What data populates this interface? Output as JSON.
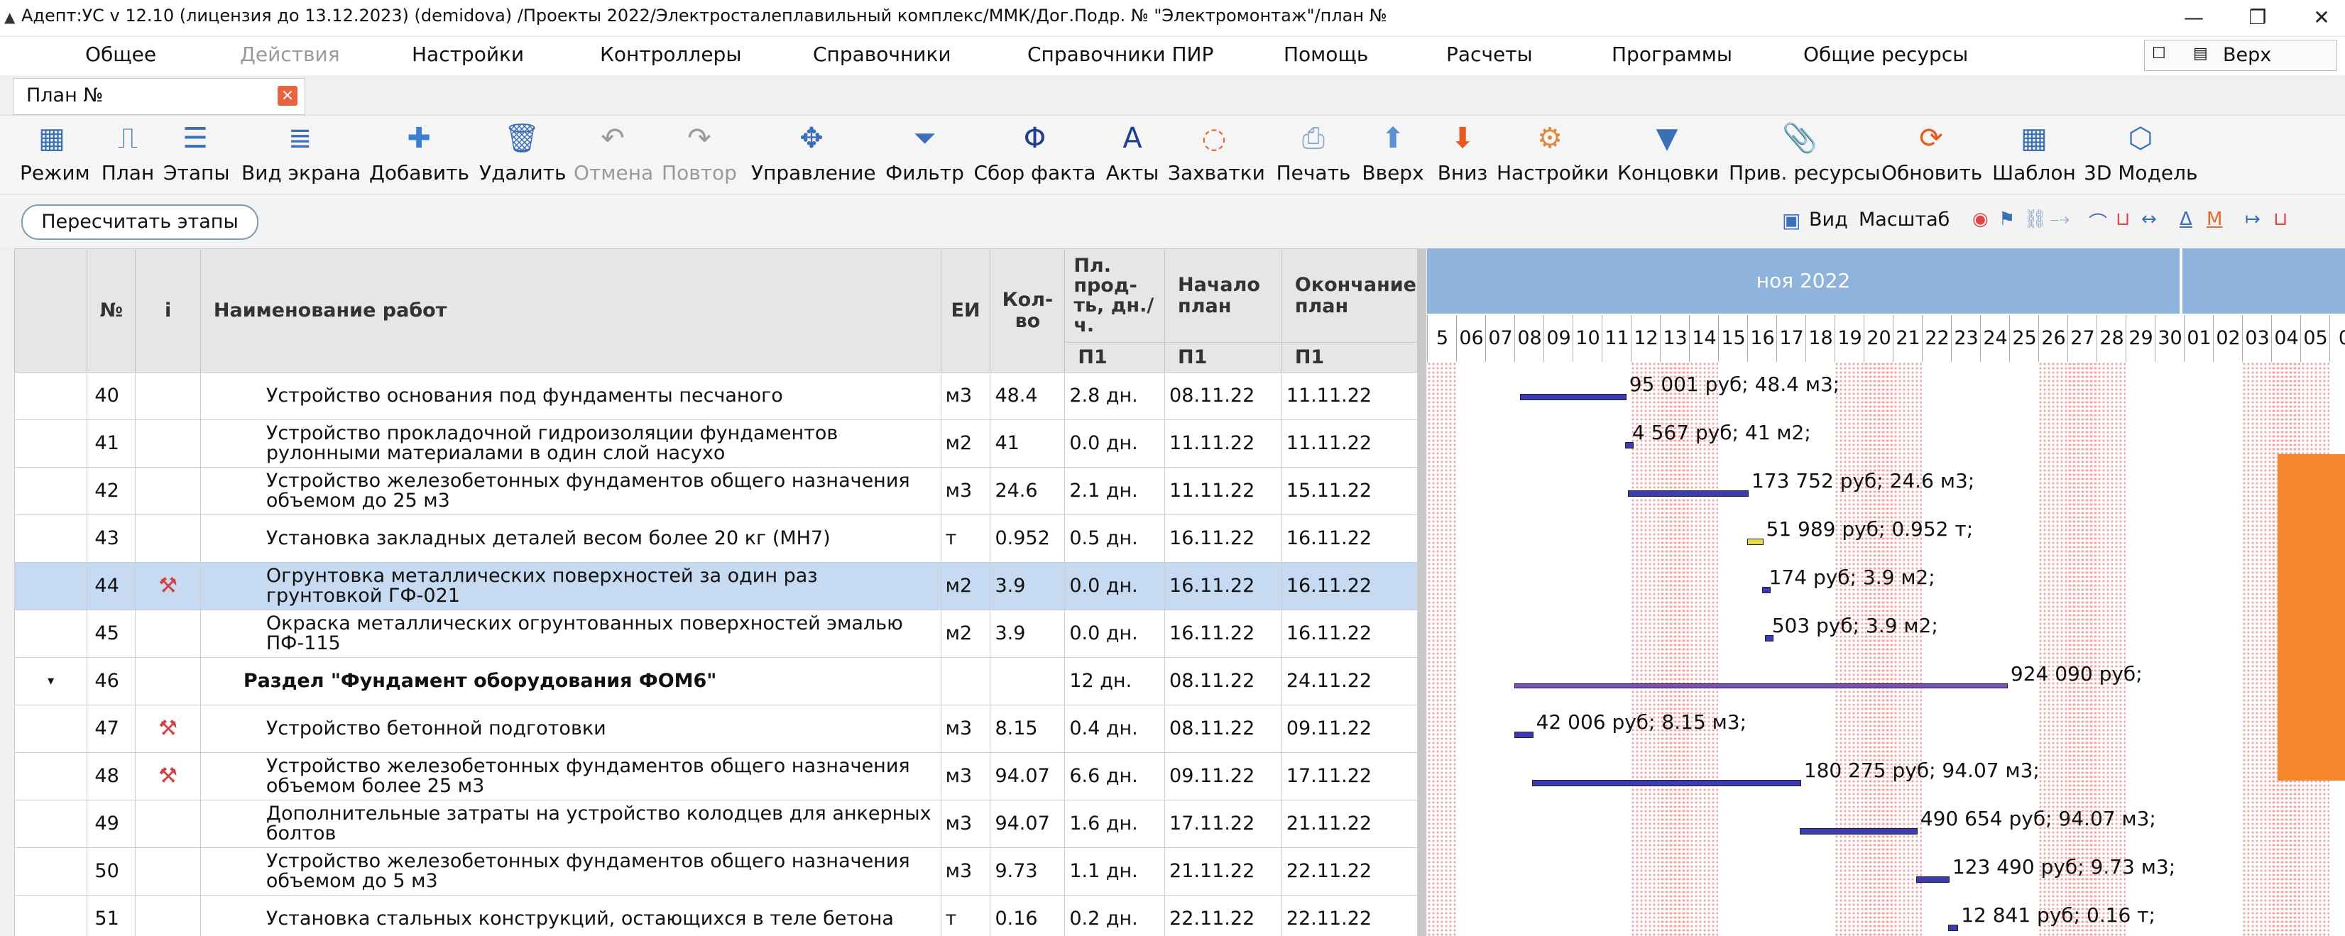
{
  "title_bar": {
    "title": "Адепт:УС v 12.10 (лицензия до 13.12.2023) (demidova) /Проекты 2022/Электросталеплавильный комплекс/ММК/Дог.Подр. №  \"Электромонтаж\"/план №",
    "minimize": "—",
    "restore": "❐",
    "close": "✕"
  },
  "menu": {
    "items": [
      "Общее",
      "Действия",
      "Настройки",
      "Контроллеры",
      "Справочники",
      "Справочники ПИР",
      "Помощь",
      "Расчеты",
      "Программы",
      "Общие ресурсы"
    ],
    "disabled_item": "Действия",
    "placement_value": "Верх"
  },
  "doc_tab": {
    "label": "План №",
    "close": "×"
  },
  "toolbar": {
    "buttons": [
      {
        "label": "Режим",
        "icon": "mode-icon"
      },
      {
        "label": "План",
        "icon": "plan-icon"
      },
      {
        "label": "Этапы",
        "icon": "stages-icon"
      },
      {
        "label": "Вид экрана",
        "icon": "screen-view-icon"
      },
      {
        "label": "Добавить",
        "icon": "add-icon"
      },
      {
        "label": "Удалить",
        "icon": "trash-icon"
      },
      {
        "label": "Отмена",
        "icon": "undo-icon"
      },
      {
        "label": "Повтор",
        "icon": "redo-icon"
      },
      {
        "label": "Управление",
        "icon": "move-icon"
      },
      {
        "label": "Фильтр",
        "icon": "filter-icon"
      },
      {
        "label": "Сбор факта",
        "icon": "fact-icon"
      },
      {
        "label": "Акты",
        "icon": "acts-icon"
      },
      {
        "label": "Захватки",
        "icon": "grips-icon"
      },
      {
        "label": "Печать",
        "icon": "print-icon"
      },
      {
        "label": "Вверх",
        "icon": "arrow-up-icon"
      },
      {
        "label": "Вниз",
        "icon": "arrow-down-icon"
      },
      {
        "label": "Настройки",
        "icon": "settings-icon"
      },
      {
        "label": "Концовки",
        "icon": "endings-icon"
      },
      {
        "label": "Прив. ресурсы",
        "icon": "resources-icon"
      },
      {
        "label": "Обновить",
        "icon": "refresh-icon"
      },
      {
        "label": "Шаблон",
        "icon": "template-icon"
      },
      {
        "label": "3D Модель",
        "icon": "model-3d-icon"
      }
    ],
    "disabled_labels": [
      "Отмена",
      "Повтор"
    ]
  },
  "actions": {
    "recalc": "Пересчитать этапы",
    "view_label": "Вид",
    "scale_label": "Масштаб"
  },
  "grid": {
    "headers": {
      "num": "№",
      "info": "i",
      "name": "Наименование работ",
      "unit": "ЕИ",
      "qty": "Кол-во",
      "duration": "Пл. прод-ть, дн./ч.",
      "start": "Начало план",
      "end": "Окончание план",
      "sub_duration": "П1",
      "sub_start": "П1",
      "sub_end": "П1"
    },
    "rows": [
      {
        "num": "40",
        "name": "Устройство основания под фундаменты песчаного",
        "unit": "м3",
        "qty": "48.4",
        "dur": "2.8 дн.",
        "start": "08.11.22",
        "end": "11.11.22",
        "icon": "",
        "section": false
      },
      {
        "num": "41",
        "name": "Устройство прокладочной гидроизоляции фундаментов рулонными материалами в один слой насухо",
        "unit": "м2",
        "qty": "41",
        "dur": "0.0 дн.",
        "start": "11.11.22",
        "end": "11.11.22",
        "icon": "",
        "section": false
      },
      {
        "num": "42",
        "name": "Устройство железобетонных фундаментов общего назначения объемом до 25 м3",
        "unit": "м3",
        "qty": "24.6",
        "dur": "2.1 дн.",
        "start": "11.11.22",
        "end": "15.11.22",
        "icon": "",
        "section": false
      },
      {
        "num": "43",
        "name": "Установка закладных деталей весом более 20 кг (МН7)",
        "unit": "т",
        "qty": "0.952",
        "dur": "0.5 дн.",
        "start": "16.11.22",
        "end": "16.11.22",
        "icon": "",
        "section": false
      },
      {
        "num": "44",
        "name": "Огрунтовка металлических поверхностей за один раз грунтовкой ГФ-021",
        "unit": "м2",
        "qty": "3.9",
        "dur": "0.0 дн.",
        "start": "16.11.22",
        "end": "16.11.22",
        "icon": "crane-icon",
        "section": false
      },
      {
        "num": "45",
        "name": "Окраска металлических огрунтованных поверхностей эмалью ПФ-115",
        "unit": "м2",
        "qty": "3.9",
        "dur": "0.0 дн.",
        "start": "16.11.22",
        "end": "16.11.22",
        "icon": "",
        "section": false
      },
      {
        "num": "46",
        "name": "Раздел \"Фундамент оборудования ФОМ6\"",
        "unit": "",
        "qty": "",
        "dur": "12 дн.",
        "start": "08.11.22",
        "end": "24.11.22",
        "icon": "",
        "section": true
      },
      {
        "num": "47",
        "name": "Устройство бетонной подготовки",
        "unit": "м3",
        "qty": "8.15",
        "dur": "0.4 дн.",
        "start": "08.11.22",
        "end": "09.11.22",
        "icon": "crane-icon",
        "section": false
      },
      {
        "num": "48",
        "name": "Устройство железобетонных фундаментов общего назначения объемом более 25 м3",
        "unit": "м3",
        "qty": "94.07",
        "dur": "6.6 дн.",
        "start": "09.11.22",
        "end": "17.11.22",
        "icon": "crane-icon",
        "section": false
      },
      {
        "num": "49",
        "name": "Дополнительные затраты на устройство колодцев для анкерных болтов",
        "unit": "м3",
        "qty": "94.07",
        "dur": "1.6 дн.",
        "start": "17.11.22",
        "end": "21.11.22",
        "icon": "",
        "section": false
      },
      {
        "num": "50",
        "name": "Устройство железобетонных фундаментов общего назначения объемом до 5 м3",
        "unit": "м3",
        "qty": "9.73",
        "dur": "1.1 дн.",
        "start": "21.11.22",
        "end": "22.11.22",
        "icon": "",
        "section": false
      },
      {
        "num": "51",
        "name": "Установка стальных конструкций, остающихся в теле бетона",
        "unit": "т",
        "qty": "0.16",
        "dur": "0.2 дн.",
        "start": "22.11.22",
        "end": "22.11.22",
        "icon": "",
        "section": false
      }
    ],
    "selected_row": "44"
  },
  "gantt": {
    "month": "ноя 2022",
    "days": [
      "5",
      "06",
      "07",
      "08",
      "09",
      "10",
      "11",
      "12",
      "13",
      "14",
      "15",
      "16",
      "17",
      "18",
      "19",
      "20",
      "21",
      "22",
      "23",
      "24",
      "25",
      "26",
      "27",
      "28",
      "29",
      "30",
      "01",
      "02",
      "03",
      "04",
      "05",
      "0"
    ],
    "labels": [
      {
        "row": 0,
        "text": "95 001 руб; 48.4 м3;",
        "start": 8.2,
        "end": 11.8
      },
      {
        "row": 1,
        "text": "4 567 руб; 41 м2;",
        "start": 11.8,
        "end": 11.9
      },
      {
        "row": 2,
        "text": "173 752 руб; 24.6 м3;",
        "start": 11.9,
        "end": 16.0
      },
      {
        "row": 3,
        "text": "51 989 руб; 0.952 т;",
        "start": 16.0,
        "end": 16.5
      },
      {
        "row": 4,
        "text": "174 руб; 3.9 м2;",
        "start": 16.5,
        "end": 16.6
      },
      {
        "row": 5,
        "text": "503 руб; 3.9 м2;",
        "start": 16.6,
        "end": 16.7
      },
      {
        "row": 6,
        "text": "924 090 руб;",
        "start": 8.0,
        "end": 24.9
      },
      {
        "row": 7,
        "text": "42 006 руб; 8.15 м3;",
        "start": 8.0,
        "end": 8.6
      },
      {
        "row": 8,
        "text": "180 275 руб; 94.07 м3;",
        "start": 8.6,
        "end": 17.8
      },
      {
        "row": 9,
        "text": "490 654 руб; 94.07 м3;",
        "start": 17.8,
        "end": 21.8
      },
      {
        "row": 10,
        "text": "123 490 руб; 9.73 м3;",
        "start": 21.8,
        "end": 22.9
      },
      {
        "row": 11,
        "text": "12 841 руб; 0.16 т;",
        "start": 22.9,
        "end": 23.2
      }
    ]
  }
}
